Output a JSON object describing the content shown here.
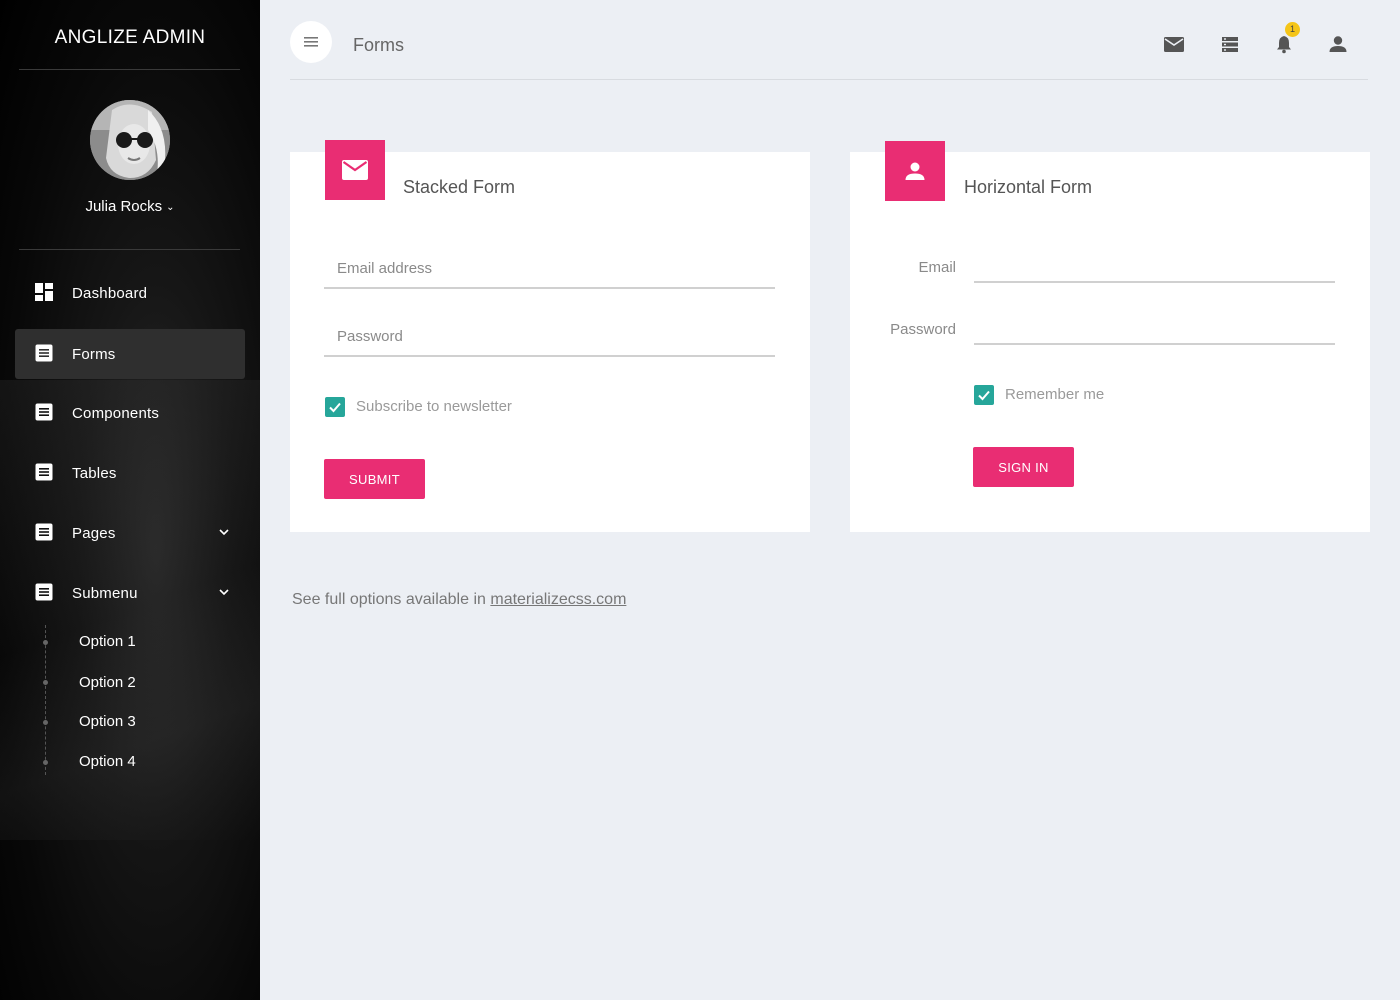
{
  "sidebar": {
    "brand": "ANGLIZE ADMIN",
    "user": {
      "name": "Julia Rocks"
    },
    "items": [
      {
        "label": "Dashboard",
        "icon": "dashboard-icon"
      },
      {
        "label": "Forms",
        "icon": "list-icon",
        "active": true
      },
      {
        "label": "Components",
        "icon": "list-icon"
      },
      {
        "label": "Tables",
        "icon": "list-icon"
      },
      {
        "label": "Pages",
        "icon": "list-icon",
        "caret": "chevron-down-icon"
      },
      {
        "label": "Submenu",
        "icon": "list-icon",
        "caret": "chevron-down-icon"
      }
    ],
    "submenu": [
      "Option 1",
      "Option 2",
      "Option 3",
      "Option 4"
    ]
  },
  "header": {
    "title": "Forms",
    "icons": [
      "mail-icon",
      "storage-icon",
      "bell-icon",
      "person-icon"
    ],
    "notification_count": "1"
  },
  "stacked_form": {
    "title": "Stacked Form",
    "email_placeholder": "Email address",
    "password_placeholder": "Password",
    "checkbox_label": "Subscribe to newsletter",
    "submit_label": "SUBMIT"
  },
  "horizontal_form": {
    "title": "Horizontal Form",
    "email_label": "Email",
    "password_label": "Password",
    "checkbox_label": "Remember me",
    "signin_label": "SIGN IN"
  },
  "footnote": {
    "text": "See full options available in ",
    "link": "materializecss.com"
  },
  "colors": {
    "accent": "#e92d73",
    "checkbox": "#26a69a",
    "badge": "#f5c518"
  }
}
